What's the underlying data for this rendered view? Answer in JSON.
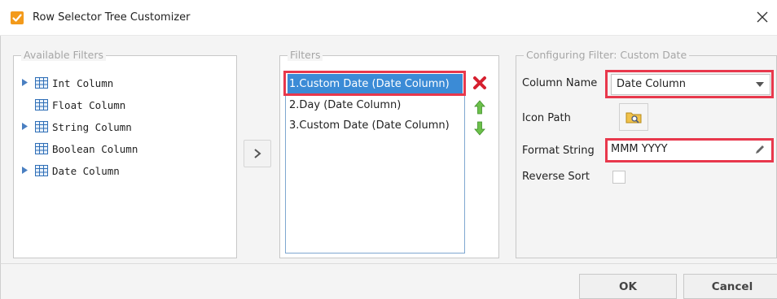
{
  "window": {
    "title": "Row Selector Tree Customizer",
    "close_icon": "close-icon",
    "app_icon": "checkmark-app-icon"
  },
  "available_filters": {
    "legend": "Available Filters",
    "items": [
      {
        "label": "Int Column",
        "expandable": true
      },
      {
        "label": "Float Column",
        "expandable": false
      },
      {
        "label": "String Column",
        "expandable": true
      },
      {
        "label": "Boolean Column",
        "expandable": false
      },
      {
        "label": "Date Column",
        "expandable": true
      }
    ]
  },
  "move_button": {
    "icon": "chevron-right-icon"
  },
  "filters": {
    "legend": "Filters",
    "items": [
      {
        "label": "1.Custom Date (Date  Column)",
        "selected": true
      },
      {
        "label": "2.Day (Date  Column)",
        "selected": false
      },
      {
        "label": "3.Custom Date (Date  Column)",
        "selected": false
      }
    ],
    "delete_icon": "delete-x-icon",
    "up_icon": "arrow-up-icon",
    "down_icon": "arrow-down-icon"
  },
  "config": {
    "legend": "Configuring Filter: Custom Date",
    "column_name_label": "Column Name",
    "column_name_value": "Date Column",
    "icon_path_label": "Icon Path",
    "format_string_label": "Format String",
    "format_string_value": "MMM YYYY",
    "reverse_sort_label": "Reverse Sort",
    "reverse_sort_checked": false
  },
  "buttons": {
    "ok": "OK",
    "cancel": "Cancel"
  },
  "colors": {
    "selection": "#3b8bd6",
    "highlight": "#e8384c",
    "app_icon": "#f39a1b"
  }
}
